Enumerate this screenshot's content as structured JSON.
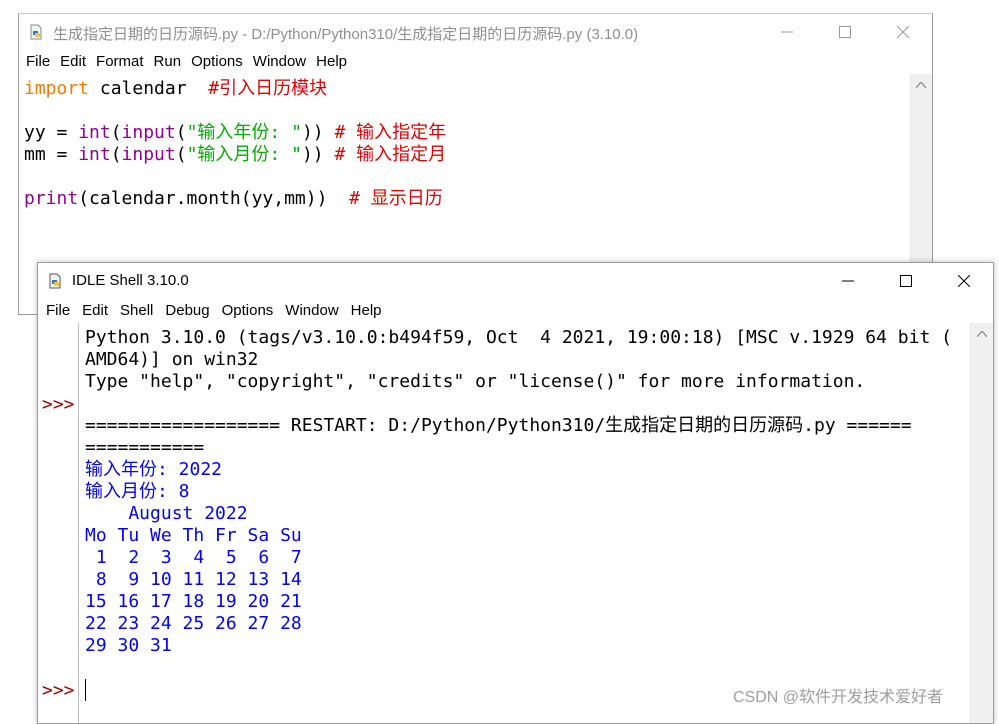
{
  "editor": {
    "title": "生成指定日期的日历源码.py - D:/Python/Python310/生成指定日期的日历源码.py (3.10.0)",
    "menu": [
      "File",
      "Edit",
      "Format",
      "Run",
      "Options",
      "Window",
      "Help"
    ],
    "code": {
      "line1": {
        "kw": "import",
        "rest": " calendar  ",
        "comment": "#引入日历模块"
      },
      "line2": {
        "var": "yy = ",
        "func": "int",
        "open": "(",
        "func2": "input",
        "open2": "(",
        "str": "\"输入年份: \"",
        "close": ")) ",
        "comment": "# 输入指定年"
      },
      "line3": {
        "var": "mm = ",
        "func": "int",
        "open": "(",
        "func2": "input",
        "open2": "(",
        "str": "\"输入月份: \"",
        "close": ")) ",
        "comment": "# 输入指定月"
      },
      "line4": {
        "func": "print",
        "rest": "(calendar.month(yy,mm))  ",
        "comment": "# 显示日历"
      }
    }
  },
  "shell": {
    "title": "IDLE Shell 3.10.0",
    "menu": [
      "File",
      "Edit",
      "Shell",
      "Debug",
      "Options",
      "Window",
      "Help"
    ],
    "prompt": ">>>",
    "banner": [
      "Python 3.10.0 (tags/v3.10.0:b494f59, Oct  4 2021, 19:00:18) [MSC v.1929 64 bit (",
      "AMD64)] on win32",
      "Type \"help\", \"copyright\", \"credits\" or \"license()\" for more information."
    ],
    "restart": [
      "================== RESTART: D:/Python/Python310/生成指定日期的日历源码.py ======",
      "==========="
    ],
    "output": [
      "输入年份: 2022",
      "输入月份: 8",
      "    August 2022",
      "Mo Tu We Th Fr Sa Su",
      " 1  2  3  4  5  6  7",
      " 8  9 10 11 12 13 14",
      "15 16 17 18 19 20 21",
      "22 23 24 25 26 27 28",
      "29 30 31"
    ]
  },
  "watermark": "CSDN @软件开发技术爱好者"
}
